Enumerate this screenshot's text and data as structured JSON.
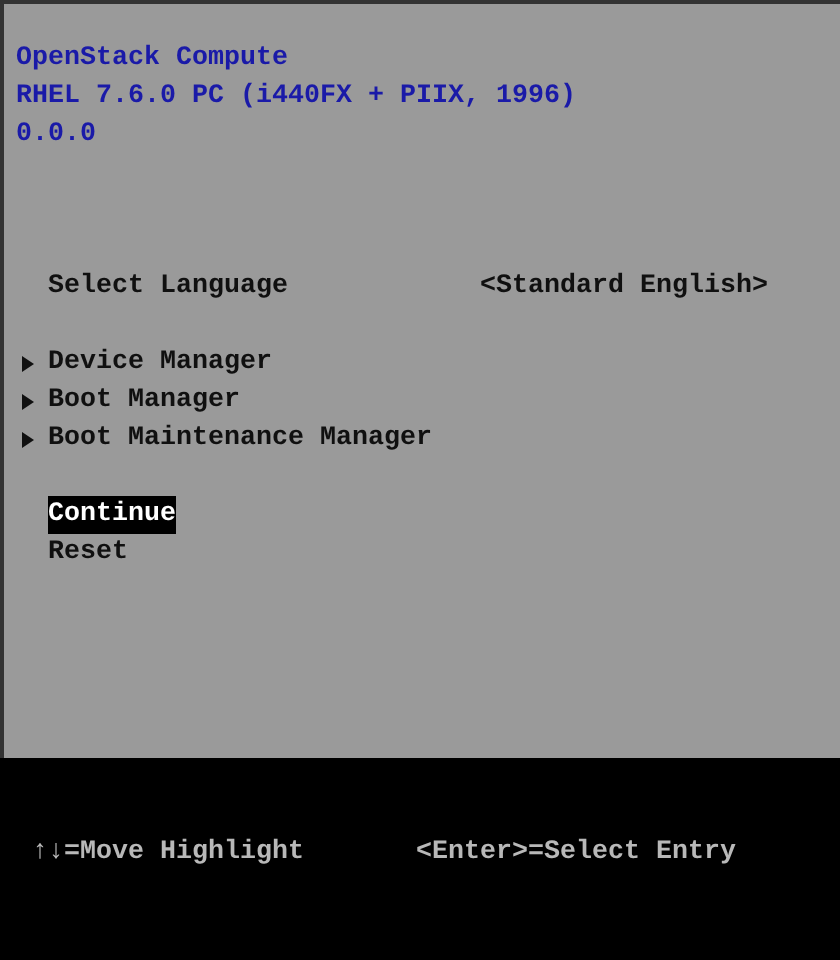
{
  "header_lines": [
    "OpenStack Compute",
    "RHEL 7.6.0 PC (i440FX + PIIX, 1996)",
    "0.0.0"
  ],
  "setting": {
    "label": "Select Language",
    "value": "<Standard English>"
  },
  "menu": [
    {
      "label": "Device Manager",
      "kind": "submenu",
      "selected": false
    },
    {
      "label": "Boot Manager",
      "kind": "submenu",
      "selected": false
    },
    {
      "label": "Boot Maintenance Manager",
      "kind": "submenu",
      "selected": false
    }
  ],
  "actions": [
    {
      "label": "Continue",
      "kind": "action",
      "selected": true
    },
    {
      "label": "Reset",
      "kind": "action",
      "selected": false
    }
  ],
  "help_bar": [
    "↑↓=Move Highlight",
    "<Enter>=Select Entry"
  ]
}
